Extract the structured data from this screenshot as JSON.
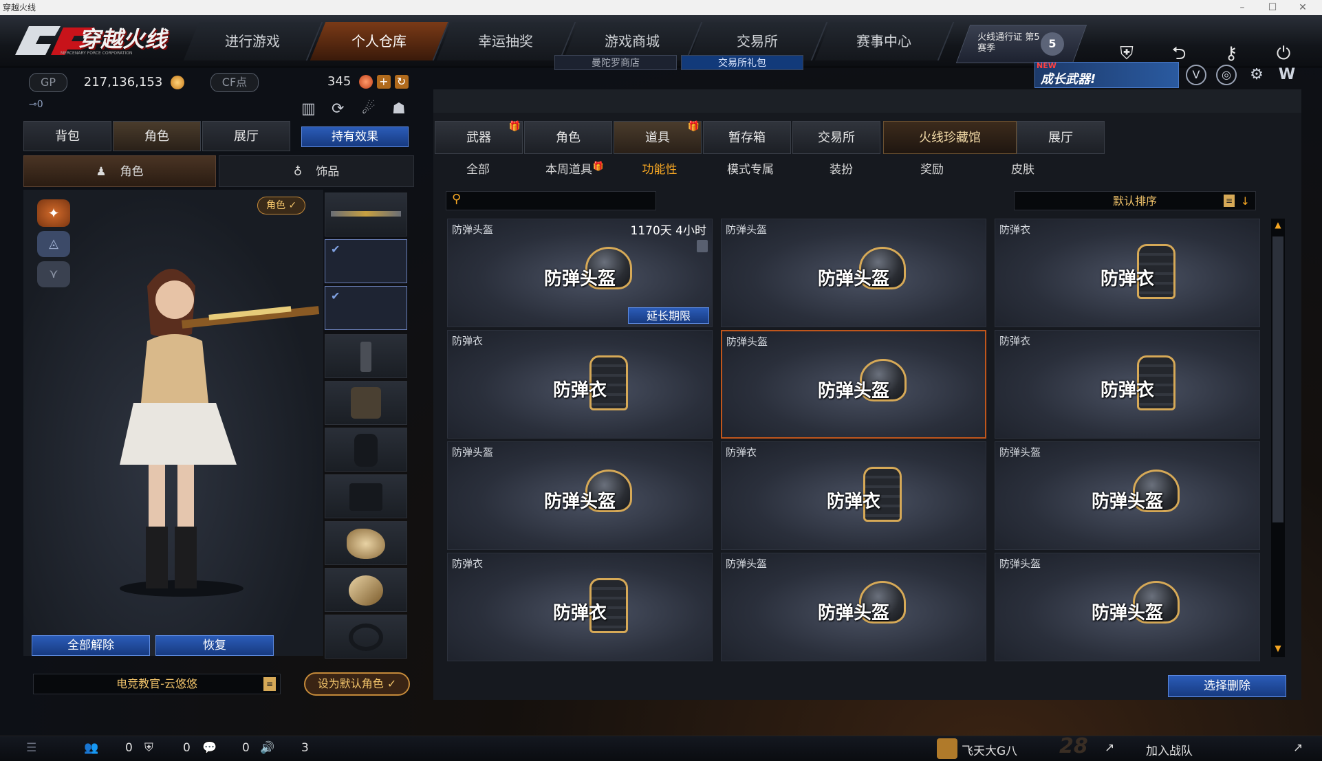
{
  "window": {
    "title": "穿越火线"
  },
  "logo": {
    "text": "穿越火线",
    "tagline": "MERCENARY FORCE CORPORATION"
  },
  "nav": {
    "items": [
      "进行游戏",
      "个人仓库",
      "幸运抽奖",
      "游戏商城",
      "交易所",
      "赛事中心"
    ],
    "active": "个人仓库",
    "sub": [
      "曼陀罗商店",
      "交易所礼包"
    ],
    "pass": "火线通行证 第5赛季",
    "pass_level": "5",
    "promo": {
      "badge": "NEW",
      "text": "成长武器!"
    },
    "icons": [
      "shield-icon",
      "exit-icon",
      "tools-icon",
      "power-icon"
    ]
  },
  "currency": {
    "gp_label": "GP",
    "gp_value": "217,136,153",
    "cf_label": "CF点",
    "cf_value": "345",
    "plus": "+"
  },
  "left": {
    "key_count": "0",
    "tabs": [
      "背包",
      "角色",
      "展厅"
    ],
    "active_tab": "角色",
    "effect_button": "持有效果",
    "subtabs": [
      "角色",
      "饰品"
    ],
    "role_badge": "角色 ✓",
    "buttons": {
      "release_all": "全部解除",
      "restore": "恢复"
    },
    "character_name": "电竞教官-云悠悠",
    "set_default": "设为默认角色 ✓"
  },
  "right": {
    "tabs": [
      "武器",
      "角色",
      "道具",
      "暂存箱",
      "交易所",
      "火线珍藏馆",
      "展厅"
    ],
    "active_tab": "道具",
    "gift_tabs": [
      "武器",
      "道具"
    ],
    "categories": [
      "全部",
      "本周道具",
      "功能性",
      "模式专属",
      "装扮",
      "奖励",
      "皮肤"
    ],
    "active_category": "功能性",
    "search_placeholder": "",
    "sort_label": "默认排序",
    "delete_button": "选择删除",
    "items": [
      {
        "name": "防弹头盔",
        "label": "防弹头盔",
        "type": "helmet",
        "time": "1170天 4小时",
        "extend": "延长期限"
      },
      {
        "name": "防弹头盔",
        "label": "防弹头盔",
        "type": "helmet"
      },
      {
        "name": "防弹衣",
        "label": "防弹衣",
        "type": "vest"
      },
      {
        "name": "防弹衣",
        "label": "防弹衣",
        "type": "vest"
      },
      {
        "name": "防弹头盔",
        "label": "防弹头盔",
        "type": "helmet",
        "selected": true
      },
      {
        "name": "防弹衣",
        "label": "防弹衣",
        "type": "vest"
      },
      {
        "name": "防弹头盔",
        "label": "防弹头盔",
        "type": "helmet"
      },
      {
        "name": "防弹衣",
        "label": "防弹衣",
        "type": "vest"
      },
      {
        "name": "防弹头盔",
        "label": "防弹头盔",
        "type": "helmet"
      },
      {
        "name": "防弹衣",
        "label": "防弹衣",
        "type": "vest"
      },
      {
        "name": "防弹头盔",
        "label": "防弹头盔",
        "type": "helmet"
      },
      {
        "name": "防弹头盔",
        "label": "防弹头盔",
        "type": "helmet"
      }
    ]
  },
  "status": {
    "friends": "0",
    "clan": "0",
    "chat": "0",
    "volume": "3",
    "user": "飞天大G八",
    "join": "加入战队",
    "level": "28"
  },
  "colors": {
    "accent": "#f5a623",
    "selected_border": "#c0561c",
    "button_blue": "#2b5cb8"
  }
}
